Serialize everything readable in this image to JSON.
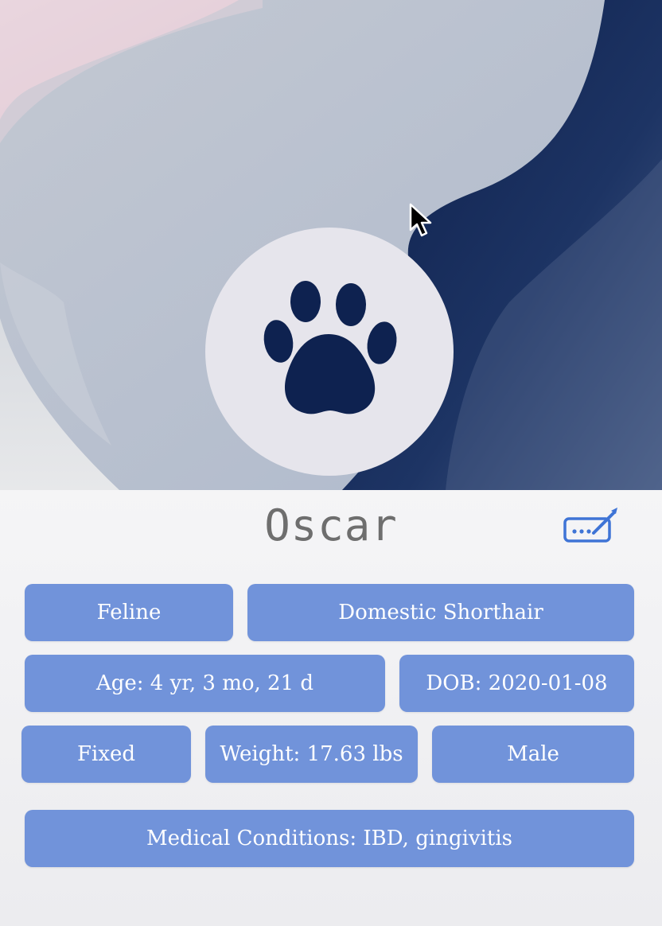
{
  "pet": {
    "name": "Oscar",
    "species": "Feline",
    "breed": "Domestic Shorthair",
    "age": "Age: 4 yr, 3 mo, 21 d",
    "dob": "DOB: 2020-01-08",
    "fixed": "Fixed",
    "weight": "Weight: 17.63 lbs",
    "sex": "Male",
    "medical": "Medical Conditions: IBD, gingivitis"
  },
  "icons": {
    "avatar": "paw-icon",
    "edit": "edit-icon",
    "cursor": "mouse-cursor-icon"
  },
  "colors": {
    "chip_background": "#7193da",
    "chip_text": "#ffffff",
    "name_text": "#6e6e6e",
    "edit_icon": "#3f74d6",
    "avatar_background": "#e6e5ec",
    "paw": "#0e2250"
  }
}
